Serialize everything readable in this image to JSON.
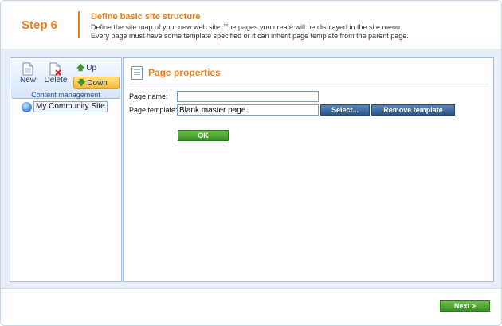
{
  "header": {
    "step": "Step 6",
    "heading": "Define basic site structure",
    "description": "Define the site map of your new web site. The pages you create will be displayed in the site menu. Every page must have some template specified or it can inherit page template from the parent page."
  },
  "toolbar": {
    "new_label": "New",
    "delete_label": "Delete",
    "up_label": "Up",
    "down_label": "Down",
    "caption": "Content management"
  },
  "tree": {
    "root_label": "My Community Site"
  },
  "properties": {
    "title": "Page properties",
    "page_name_label": "Page name:",
    "page_name_value": "",
    "page_template_label": "Page template:",
    "page_template_value": "Blank master page",
    "select_label": "Select...",
    "remove_label": "Remove template",
    "ok_label": "OK"
  },
  "footer": {
    "next_label": "Next >"
  },
  "colors": {
    "accent": "#f07d17",
    "panel_border": "#a8bdd8",
    "band": "#e7eef8"
  }
}
